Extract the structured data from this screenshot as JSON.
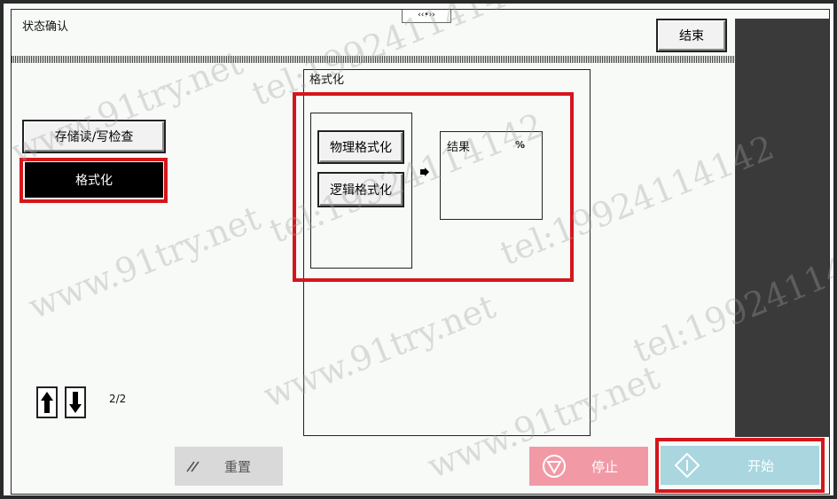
{
  "header": {
    "title": "状态确认",
    "end_label": "结束",
    "handle_glyph": "‹‹•››"
  },
  "sidebar": {
    "items": [
      {
        "label": "存储读/写检查"
      },
      {
        "label": "格式化"
      }
    ],
    "page_indicator": "2/2"
  },
  "main": {
    "panel_title": "格式化",
    "buttons": [
      {
        "label": "物理格式化"
      },
      {
        "label": "逻辑格式化"
      }
    ],
    "result": {
      "label": "结果",
      "unit": "%"
    }
  },
  "footer": {
    "reset_label": "重置",
    "stop_label": "停止",
    "start_label": "开始"
  },
  "watermarks": [
    "www.91try.net",
    "tel:19924114142"
  ],
  "colors": {
    "highlight_red": "#d4161c",
    "stop_pink": "#f19aa6",
    "start_blue": "#a9d6df",
    "reset_gray": "#d9d9d9"
  }
}
